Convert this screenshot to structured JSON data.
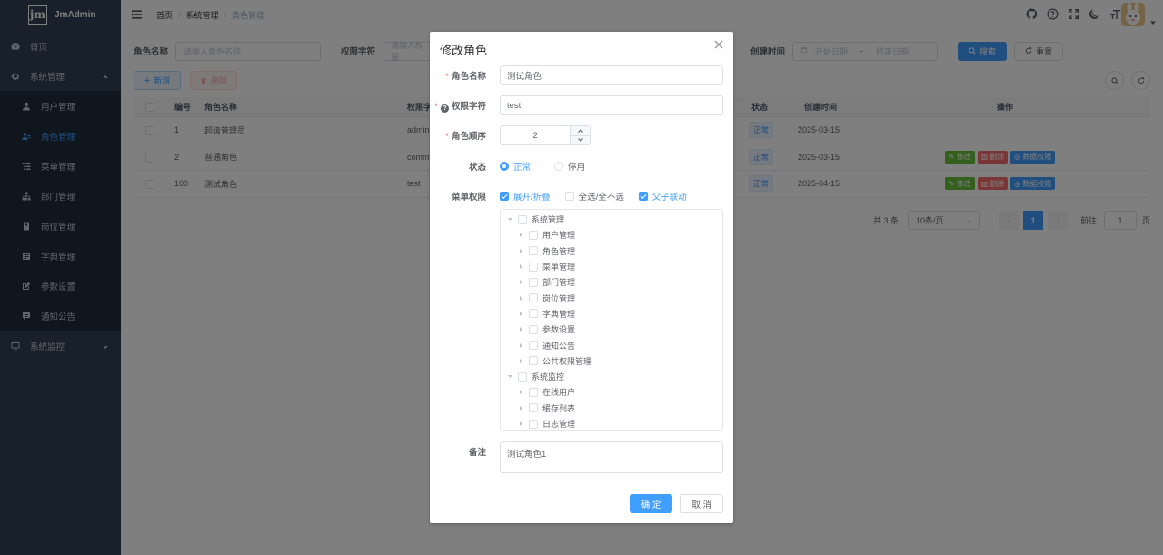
{
  "app": {
    "logo_mark": "jm",
    "name": "JmAdmin"
  },
  "sidebar": {
    "home": "首页",
    "system": "系统管理",
    "items": [
      "用户管理",
      "角色管理",
      "菜单管理",
      "部门管理",
      "岗位管理",
      "字典管理",
      "参数设置",
      "通知公告"
    ],
    "monitor": "系统监控"
  },
  "breadcrumb": {
    "home": "首页",
    "section": "系统管理",
    "page": "角色管理"
  },
  "search": {
    "role_name_label": "角色名称",
    "role_name_placeholder": "请输入角色名称",
    "perm_label": "权限字符",
    "perm_placeholder": "请输入权限",
    "created_label": "创建时间",
    "start_placeholder": "开始日期",
    "range_sep": "-",
    "end_placeholder": "结束日期",
    "search_btn": "搜索",
    "reset_btn": "重置"
  },
  "toolbar": {
    "add": "新增",
    "delete": "删除"
  },
  "table": {
    "headers": {
      "id": "编号",
      "name": "角色名称",
      "perm": "权限字",
      "status": "状态",
      "created": "创建时间",
      "ops": "操作"
    },
    "rows": [
      {
        "id": "1",
        "name": "超级管理员",
        "perm": "admin",
        "status": "正常",
        "created": "2025-03-15"
      },
      {
        "id": "2",
        "name": "普通角色",
        "perm": "comm",
        "status": "正常",
        "created": "2025-03-15"
      },
      {
        "id": "100",
        "name": "测试角色",
        "perm": "test",
        "status": "正常",
        "created": "2025-04-15"
      }
    ],
    "ops": {
      "edit": "修改",
      "delete": "删除",
      "data_perm": "数据权限"
    }
  },
  "pagination": {
    "total": "共 3 条",
    "page_size": "10条/页",
    "current": "1",
    "goto_label": "前往",
    "goto_value": "1",
    "page_unit": "页"
  },
  "dialog": {
    "title": "修改角色",
    "role_name_label": "角色名称",
    "role_name_value": "测试角色",
    "perm_label": "权限字符",
    "perm_value": "test",
    "order_label": "角色顺序",
    "order_value": "2",
    "status_label": "状态",
    "status_normal": "正常",
    "status_disabled": "停用",
    "menu_perm_label": "菜单权限",
    "opt_expand": "展开/折叠",
    "opt_select_all": "全选/全不选",
    "opt_linkage": "父子联动",
    "tree": [
      {
        "label": "系统管理",
        "level": 0,
        "state": "half"
      },
      {
        "label": "用户管理",
        "level": 1,
        "state": "on"
      },
      {
        "label": "角色管理",
        "level": 1,
        "state": "on"
      },
      {
        "label": "菜单管理",
        "level": 1,
        "state": "half"
      },
      {
        "label": "部门管理",
        "level": 1,
        "state": "on"
      },
      {
        "label": "岗位管理",
        "level": 1,
        "state": "on"
      },
      {
        "label": "字典管理",
        "level": 1,
        "state": "on"
      },
      {
        "label": "参数设置",
        "level": 1,
        "state": "off"
      },
      {
        "label": "通知公告",
        "level": 1,
        "state": "half"
      },
      {
        "label": "公共权限管理",
        "level": 1,
        "state": "on"
      },
      {
        "label": "系统监控",
        "level": 0,
        "state": "half"
      },
      {
        "label": "在线用户",
        "level": 1,
        "state": "on"
      },
      {
        "label": "缓存列表",
        "level": 1,
        "state": "on"
      },
      {
        "label": "日志管理",
        "level": 1,
        "state": "half"
      }
    ],
    "remark_label": "备注",
    "remark_value": "测试角色1",
    "confirm": "确 定",
    "cancel": "取 消"
  },
  "colors": {
    "primary": "#409eff",
    "sidebar": "#304156",
    "submenu": "#1f2d3d"
  }
}
